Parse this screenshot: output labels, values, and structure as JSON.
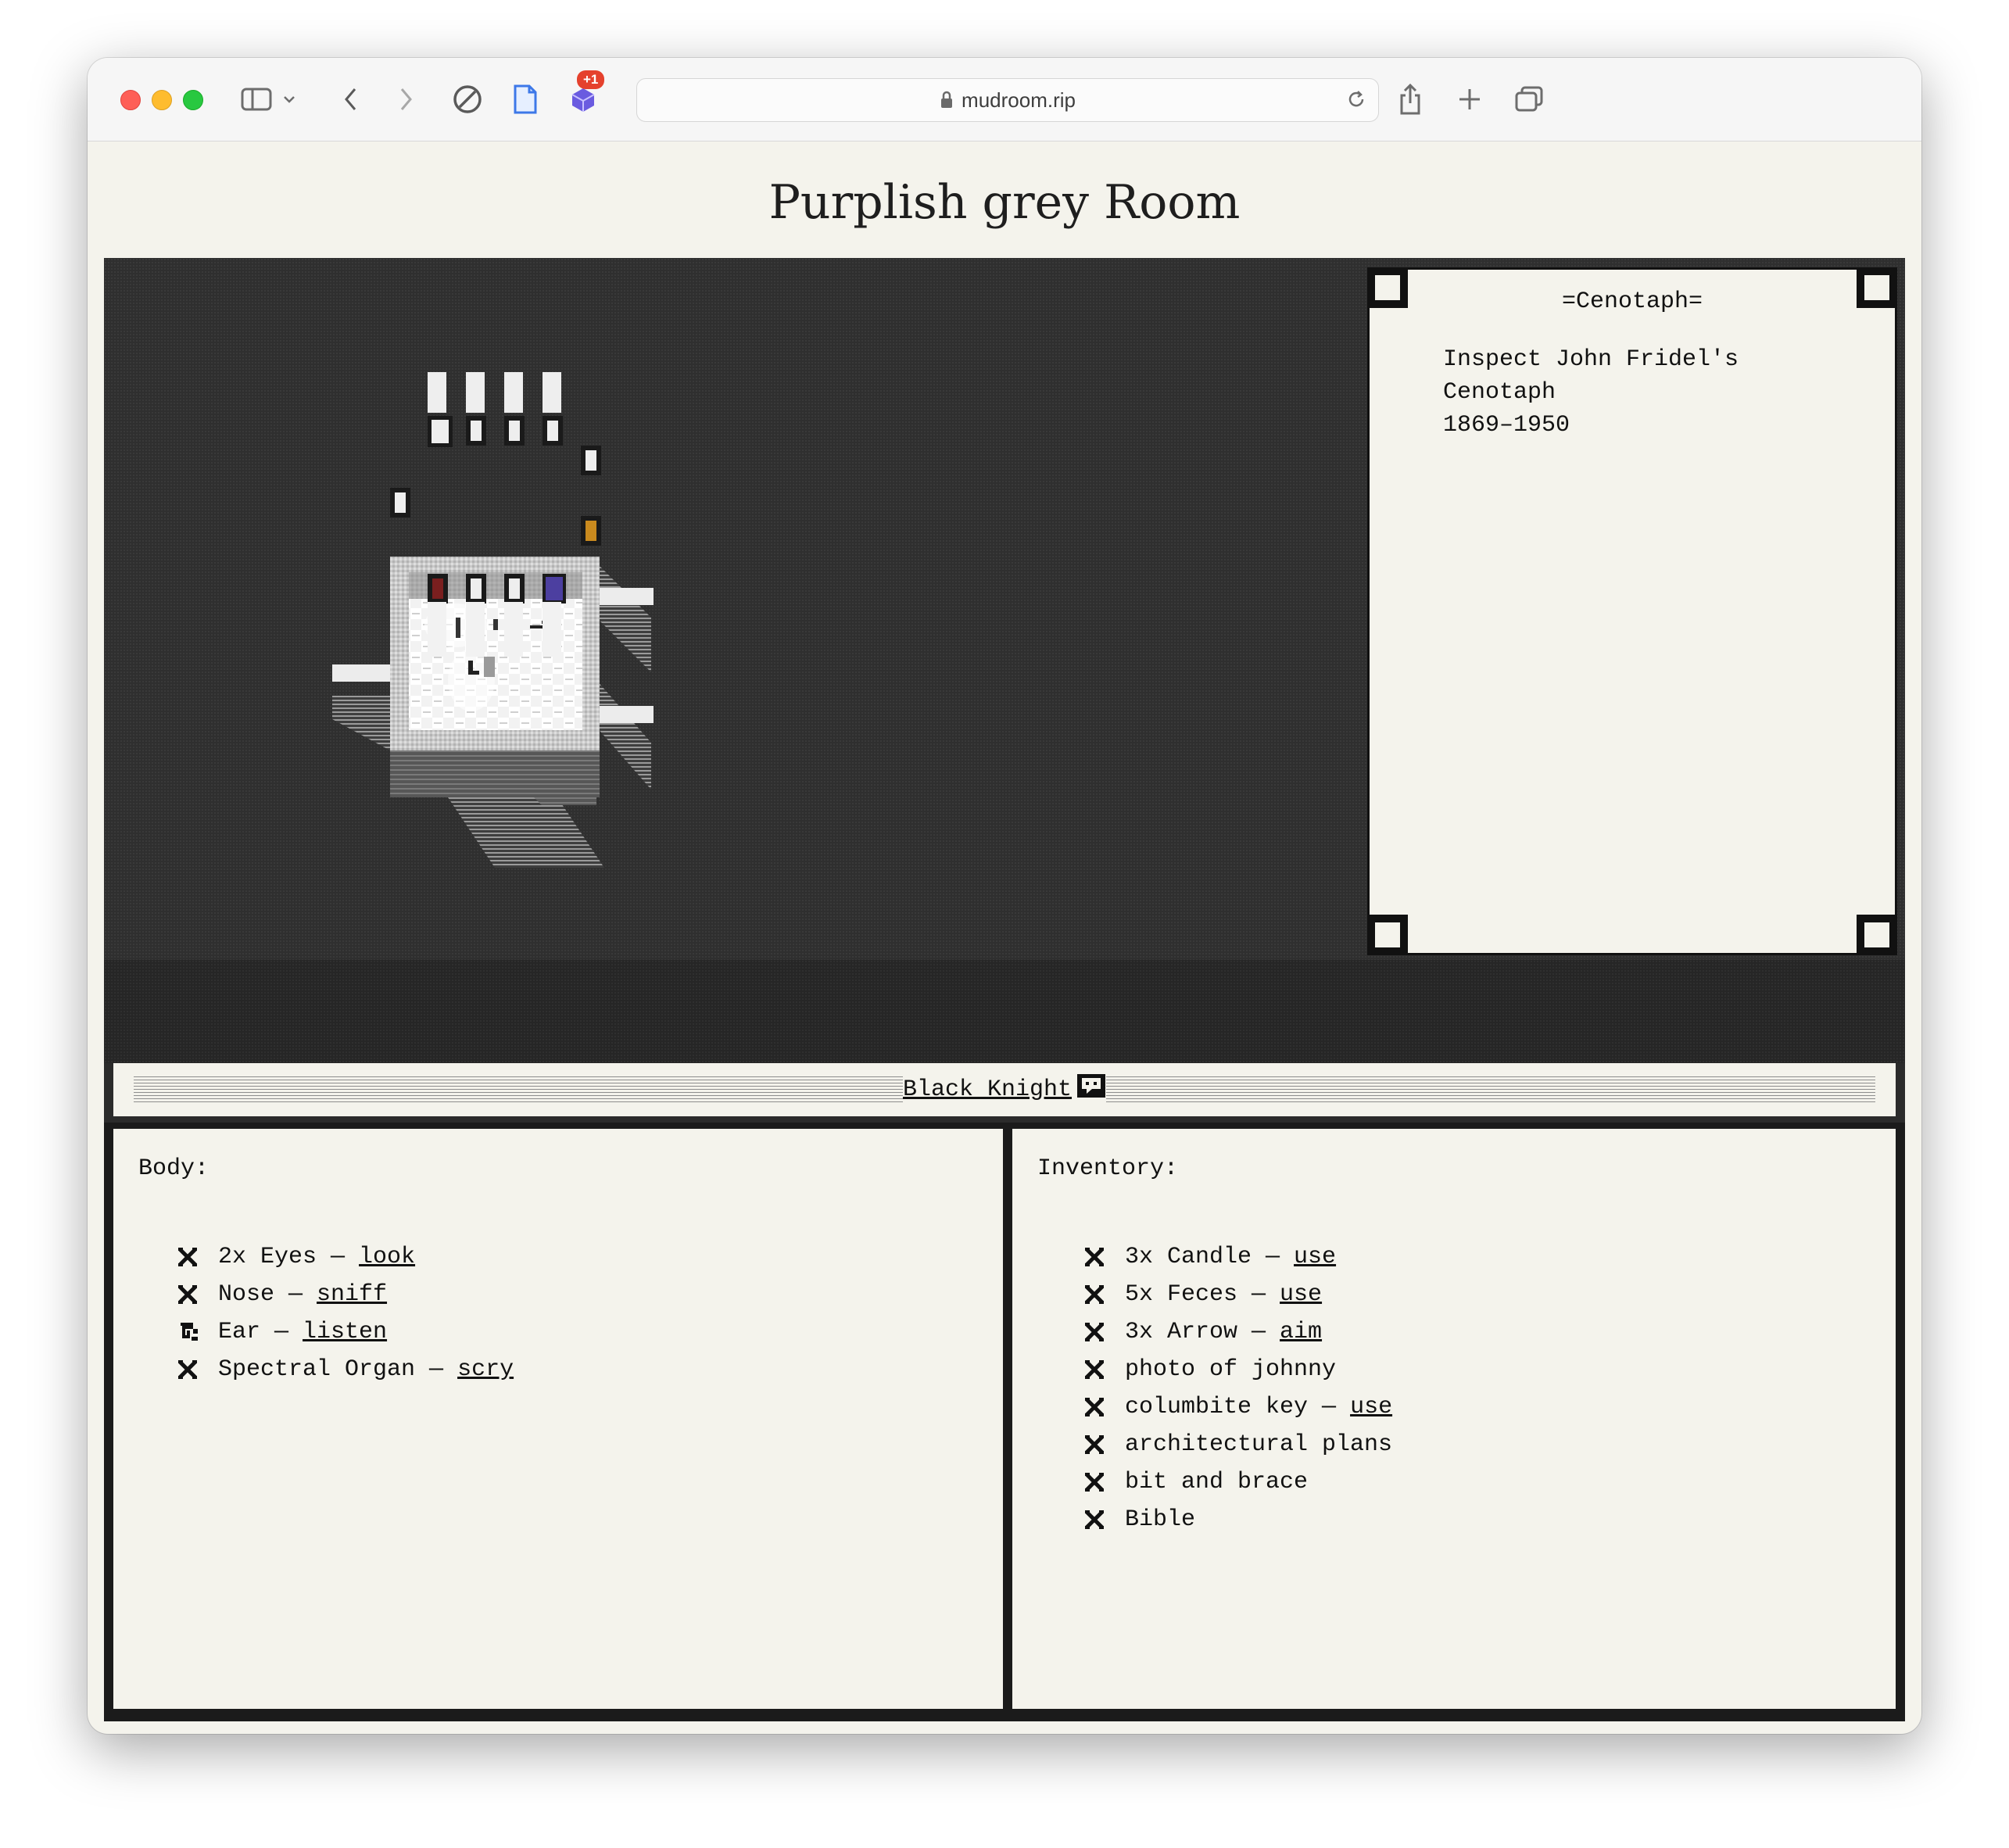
{
  "browser": {
    "url": "mudroom.rip",
    "extension_badge": "+1"
  },
  "page": {
    "title": "Purplish grey Room"
  },
  "panel": {
    "title": "=Cenotaph=",
    "lines": [
      "Inspect John Fridel's",
      "Cenotaph",
      "1869–1950"
    ]
  },
  "character": {
    "name": "Black Knight"
  },
  "body": {
    "heading": "Body:",
    "items": [
      {
        "text": "2x Eyes",
        "sep": " — ",
        "action": "look",
        "icon": "cross-icon"
      },
      {
        "text": "Nose",
        "sep": " — ",
        "action": "sniff",
        "icon": "cross-icon"
      },
      {
        "text": "Ear",
        "sep": " — ",
        "action": "listen",
        "icon": "spiral-icon"
      },
      {
        "text": "Spectral Organ",
        "sep": " — ",
        "action": "scry",
        "icon": "cross-icon"
      }
    ]
  },
  "inventory": {
    "heading": "Inventory:",
    "items": [
      {
        "text": "3x Candle",
        "sep": " — ",
        "action": "use"
      },
      {
        "text": "5x Feces",
        "sep": " — ",
        "action": "use"
      },
      {
        "text": "3x Arrow",
        "sep": " — ",
        "action": "aim"
      },
      {
        "text": "photo of johnny",
        "sep": "",
        "action": ""
      },
      {
        "text": "columbite key",
        "sep": " — ",
        "action": "use"
      },
      {
        "text": "architectural plans",
        "sep": "",
        "action": ""
      },
      {
        "text": "bit and brace",
        "sep": "",
        "action": ""
      },
      {
        "text": "Bible",
        "sep": "",
        "action": ""
      }
    ]
  },
  "colors": {
    "door_red": "#7a1f1f",
    "door_orange": "#c98a1e",
    "door_purple": "#4c3fa0",
    "background_dark": "#2f2f2f",
    "paper": "#f4f3ec"
  }
}
